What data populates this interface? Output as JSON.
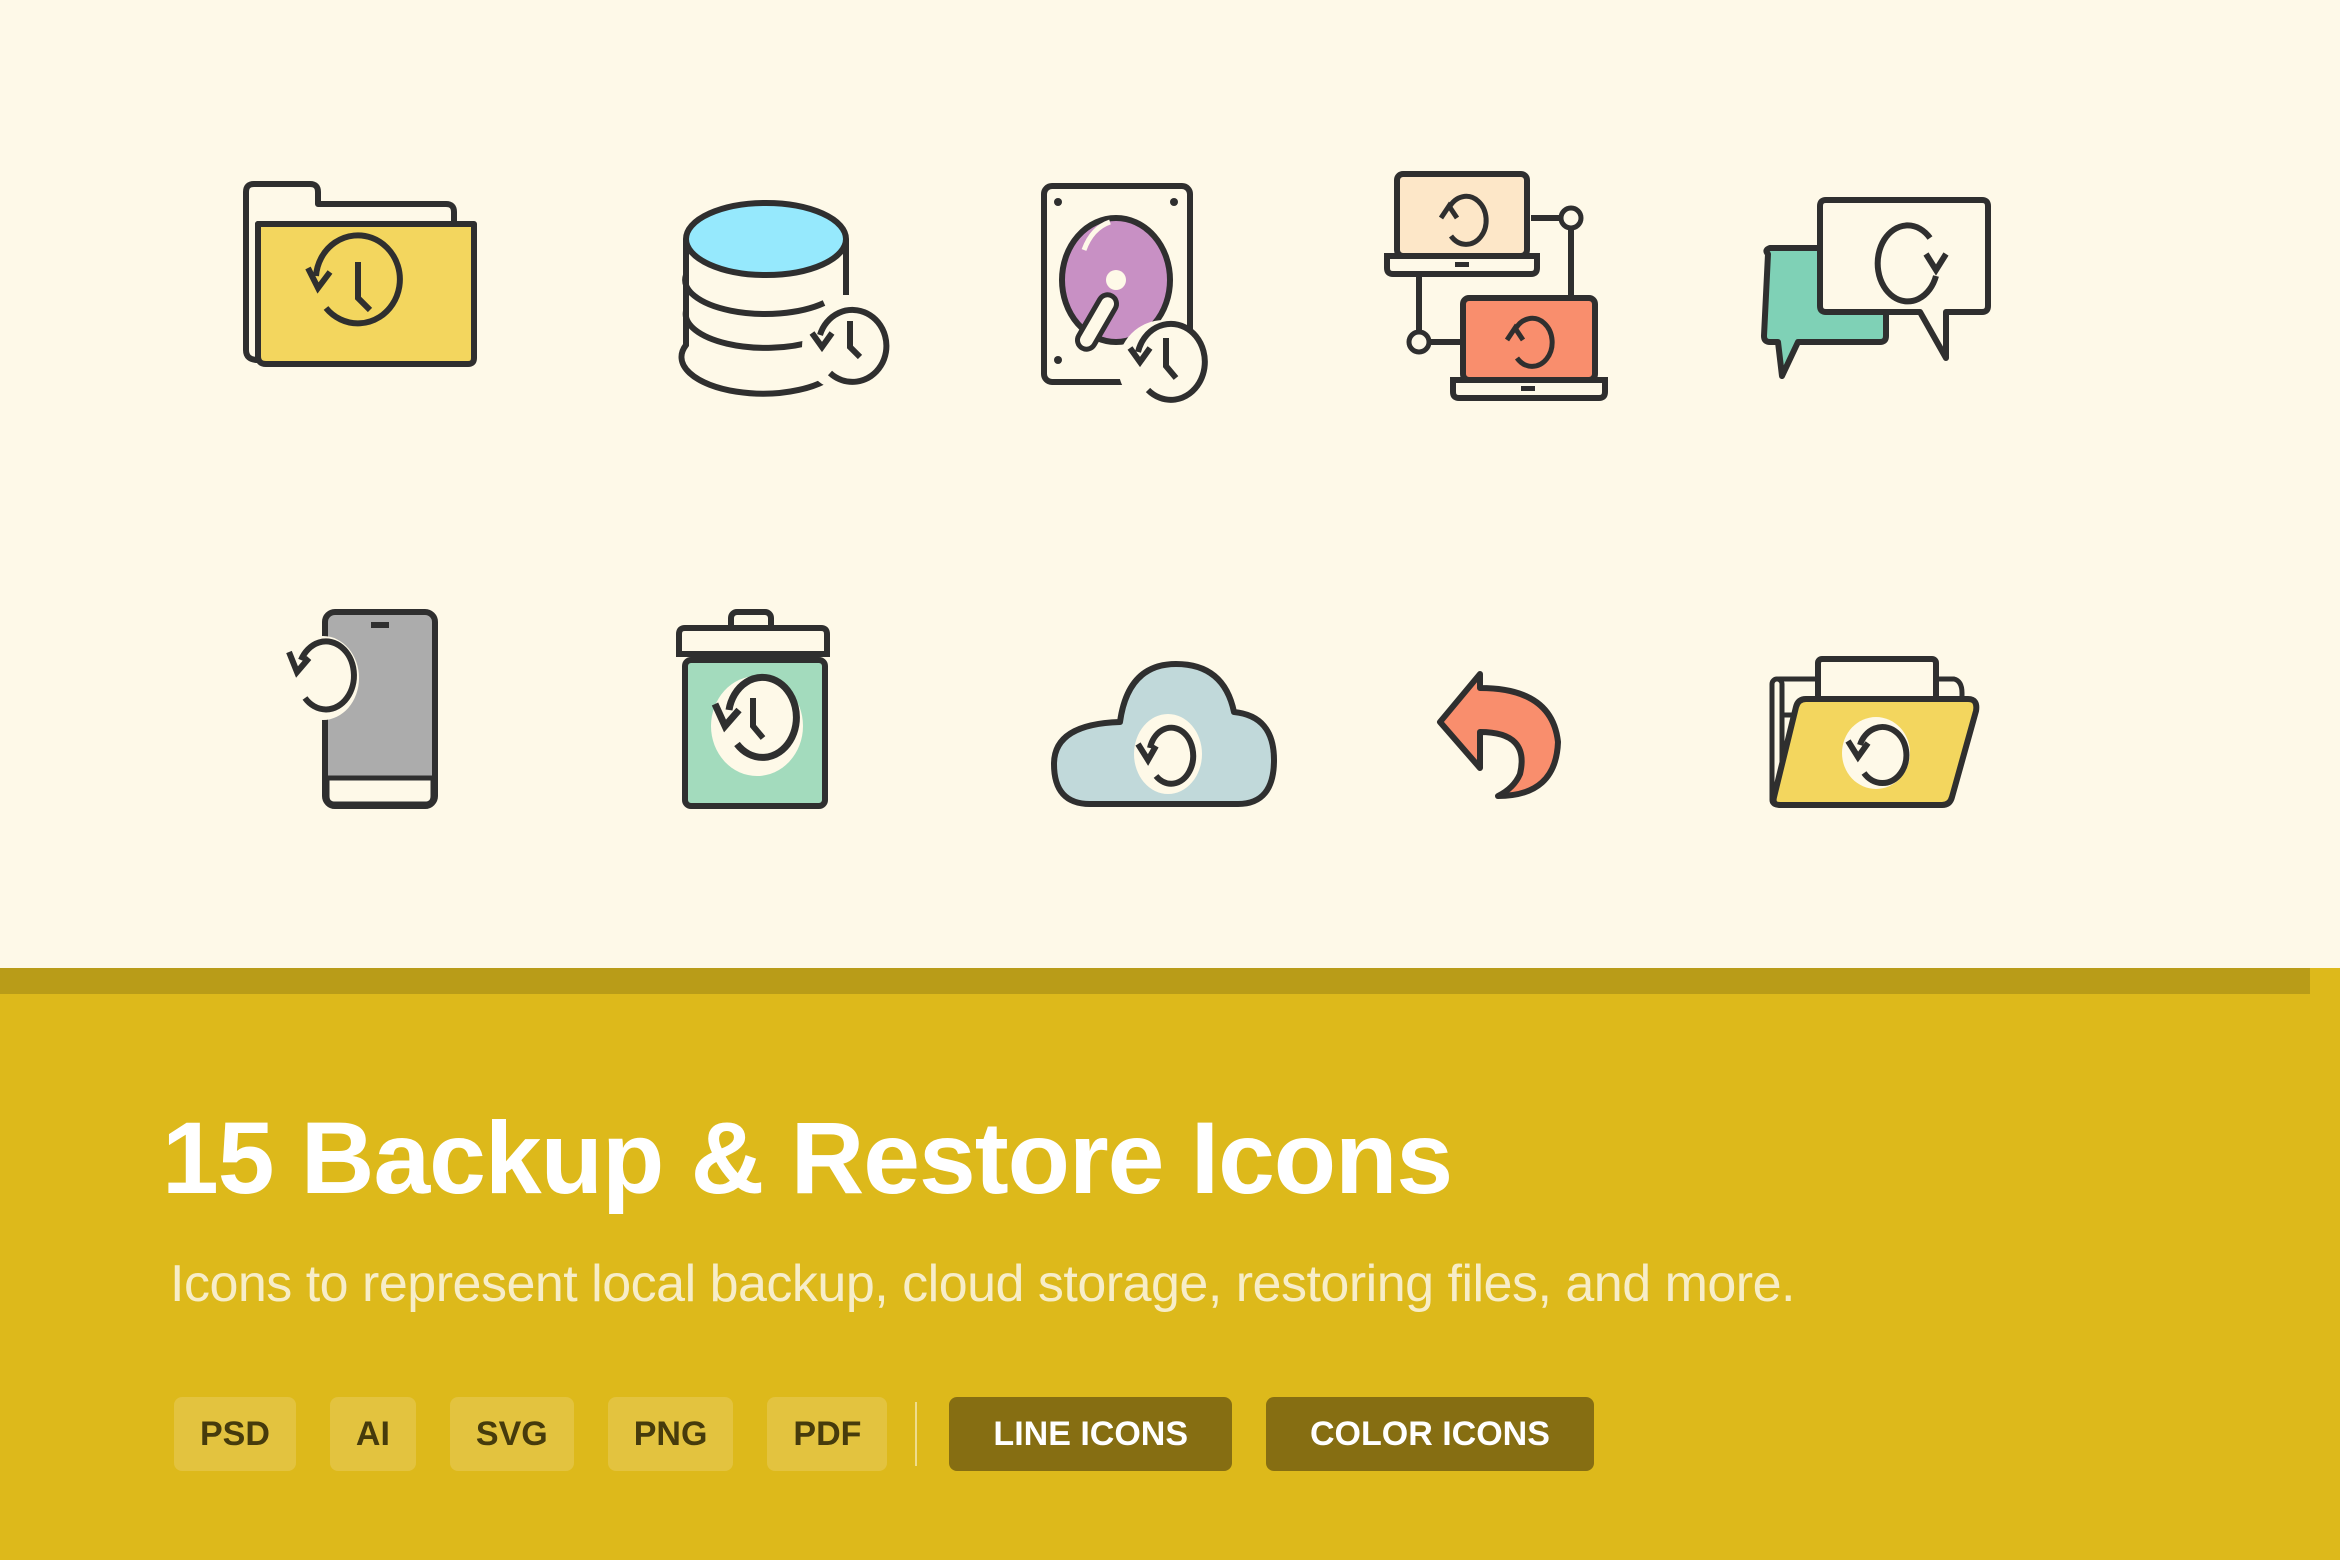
{
  "title": "15 Backup & Restore Icons",
  "subtitle": "Icons to represent local backup, cloud storage, restoring files, and more.",
  "formats": [
    "PSD",
    "AI",
    "SVG",
    "PNG",
    "PDF"
  ],
  "styles": [
    "LINE ICONS",
    "COLOR ICONS"
  ],
  "icons": [
    {
      "name": "folder-history",
      "fill": "#f3d65e"
    },
    {
      "name": "database-history",
      "fill": "#96e9fd"
    },
    {
      "name": "hard-drive-history",
      "fill": "#c890c4"
    },
    {
      "name": "laptop-sync",
      "fill": "#fde7c8",
      "fill2": "#f98e6d"
    },
    {
      "name": "chat-refresh",
      "fill": "#7fd1b6"
    },
    {
      "name": "phone-restore",
      "fill": "#acacac"
    },
    {
      "name": "trash-restore",
      "fill": "#a3dbbd"
    },
    {
      "name": "cloud-restore",
      "fill": "#c1d9da"
    },
    {
      "name": "undo-arrow",
      "fill": "#f98e6d"
    },
    {
      "name": "open-folder-restore",
      "fill": "#f3d65e"
    }
  ],
  "colors": {
    "background_top": "#fef9e8",
    "band": "#b99c18",
    "background_bottom": "#ddb91b",
    "stroke": "#2f2f2f",
    "format_tag": "#e3c33f",
    "style_tag": "#866e12"
  }
}
